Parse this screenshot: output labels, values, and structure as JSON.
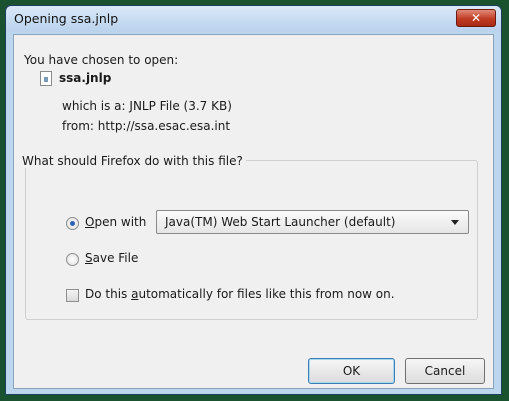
{
  "window": {
    "title": "Opening ssa.jnlp",
    "close_glyph": "✕"
  },
  "dialog": {
    "intro": "You have chosen to open:",
    "file_name": "ssa.jnlp",
    "type_label": "which is a:",
    "type_value": "JNLP File (3.7 KB)",
    "from_label": "from:",
    "from_value": "http://ssa.esac.esa.int"
  },
  "action_group": {
    "legend": "What should Firefox do with this file?",
    "open_with_prefix": "",
    "open_with_access": "O",
    "open_with_rest": "pen with",
    "open_with_selected": true,
    "app_selected": "Java(TM) Web Start Launcher (default)",
    "save_access": "S",
    "save_rest": "ave File",
    "auto_before": "Do this ",
    "auto_access": "a",
    "auto_after": "utomatically for files like this from now on.",
    "auto_checked": false
  },
  "buttons": {
    "ok": "OK",
    "cancel": "Cancel"
  },
  "colors": {
    "desktop": "#1a5230",
    "frame": "#bcd6ee",
    "close_button": "#c13c24",
    "radio_dot": "#2d61b2"
  }
}
